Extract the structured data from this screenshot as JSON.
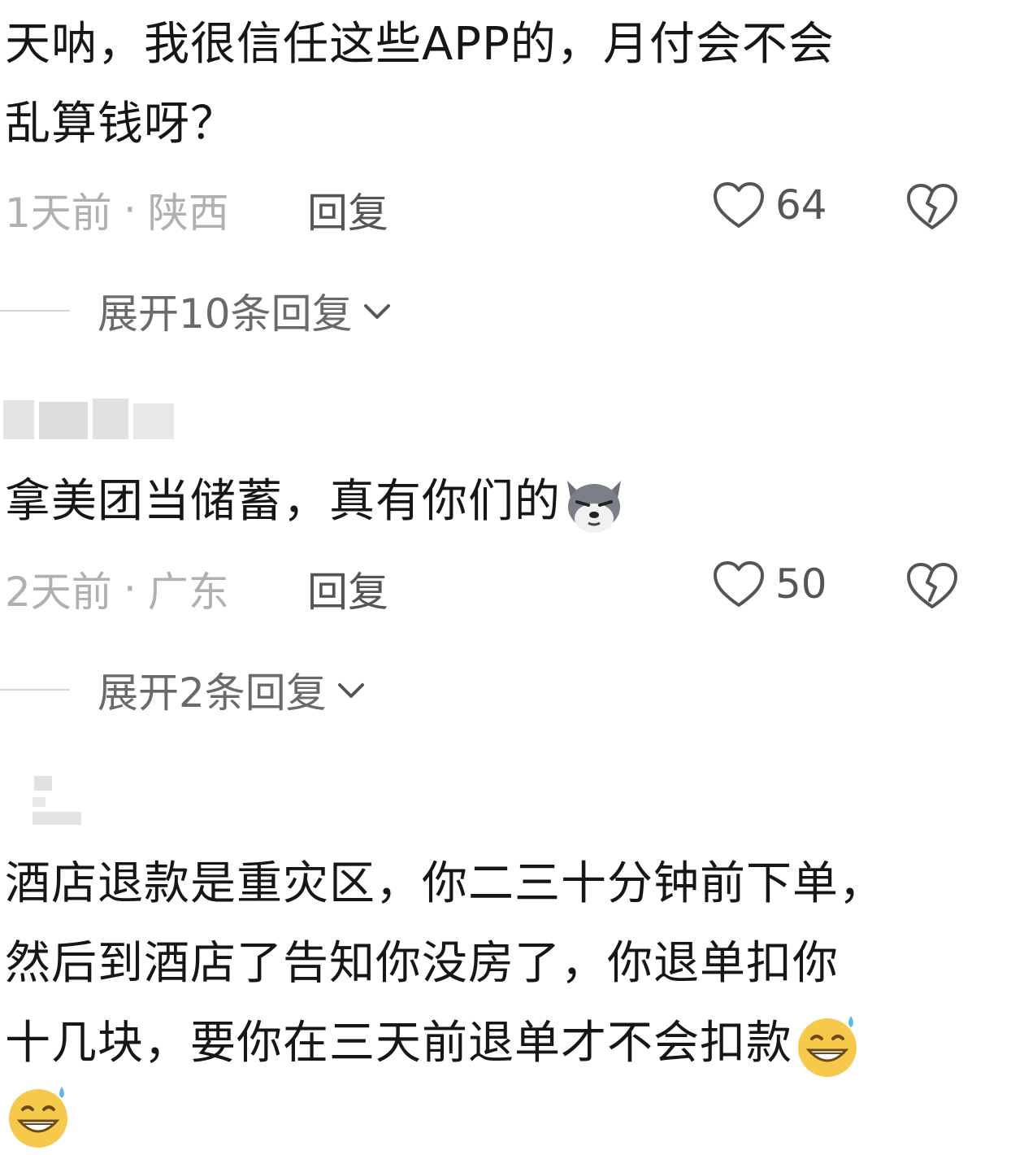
{
  "comments": [
    {
      "lines": [
        "天呐，我很信任这些APP的，月付会不会",
        "乱算钱呀？"
      ],
      "time": "1天前",
      "separator": "·",
      "location": "陕西",
      "reply_label": "回复",
      "likes": "64",
      "expand_label": "展开10条回复"
    },
    {
      "lines": [
        "拿美团当储蓄，真有你们的"
      ],
      "emoji": "wolf-face-emoji",
      "time": "2天前",
      "separator": "·",
      "location": "广东",
      "reply_label": "回复",
      "likes": "50",
      "expand_label": "展开2条回复"
    },
    {
      "lines": [
        "酒店退款是重灾区，你二三十分钟前下单，",
        "然后到酒店了告知你没房了，你退单扣你",
        "十几块，要你在三天前退单才不会扣款"
      ],
      "emoji": "grinning-sweat-emoji"
    }
  ],
  "colors": {
    "text": "#161616",
    "meta": "#b0b0b0",
    "secondary": "#555555",
    "divider": "#d6d6d6"
  }
}
